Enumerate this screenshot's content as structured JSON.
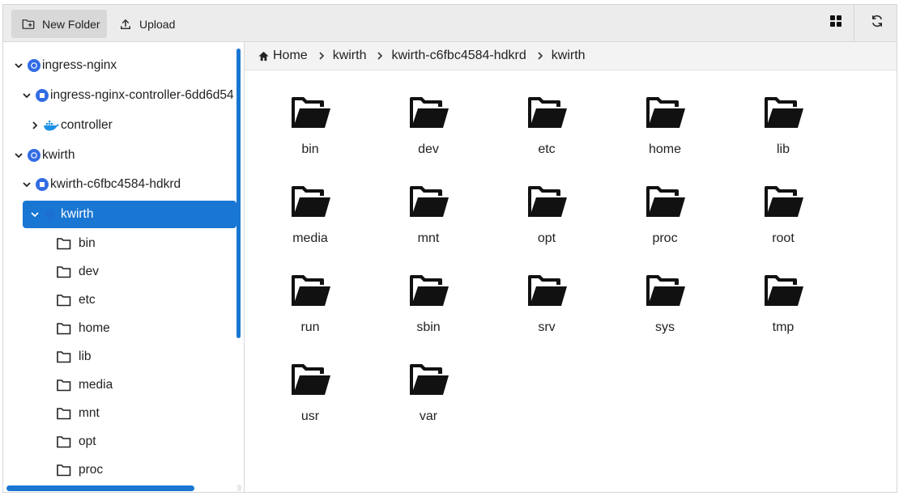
{
  "toolbar": {
    "new_folder_label": "New Folder",
    "upload_label": "Upload"
  },
  "tree": [
    {
      "label": "ingress-nginx",
      "kind": "k8s",
      "expanded": true,
      "level": 0
    },
    {
      "label": "ingress-nginx-controller-6dd6d54",
      "kind": "k8s",
      "expanded": true,
      "level": 1
    },
    {
      "label": "controller",
      "kind": "docker",
      "expanded": false,
      "level": 2
    },
    {
      "label": "kwirth",
      "kind": "k8s",
      "expanded": true,
      "level": 0
    },
    {
      "label": "kwirth-c6fbc4584-hdkrd",
      "kind": "k8s",
      "expanded": true,
      "level": 1
    },
    {
      "label": "kwirth",
      "kind": "docker",
      "expanded": true,
      "level": 2,
      "selected": true
    },
    {
      "label": "bin",
      "kind": "folder",
      "level": 3
    },
    {
      "label": "dev",
      "kind": "folder",
      "level": 3
    },
    {
      "label": "etc",
      "kind": "folder",
      "level": 3
    },
    {
      "label": "home",
      "kind": "folder",
      "level": 3
    },
    {
      "label": "lib",
      "kind": "folder",
      "level": 3
    },
    {
      "label": "media",
      "kind": "folder",
      "level": 3
    },
    {
      "label": "mnt",
      "kind": "folder",
      "level": 3
    },
    {
      "label": "opt",
      "kind": "folder",
      "level": 3
    },
    {
      "label": "proc",
      "kind": "folder",
      "level": 3
    }
  ],
  "breadcrumb": [
    "Home",
    "kwirth",
    "kwirth-c6fbc4584-hdkrd",
    "kwirth"
  ],
  "folders": [
    "bin",
    "dev",
    "etc",
    "home",
    "lib",
    "media",
    "mnt",
    "opt",
    "proc",
    "root",
    "run",
    "sbin",
    "srv",
    "sys",
    "tmp",
    "usr",
    "var"
  ],
  "colors": {
    "accent": "#1976d2",
    "k8s": "#326ce5",
    "docker": "#1d91e6"
  }
}
